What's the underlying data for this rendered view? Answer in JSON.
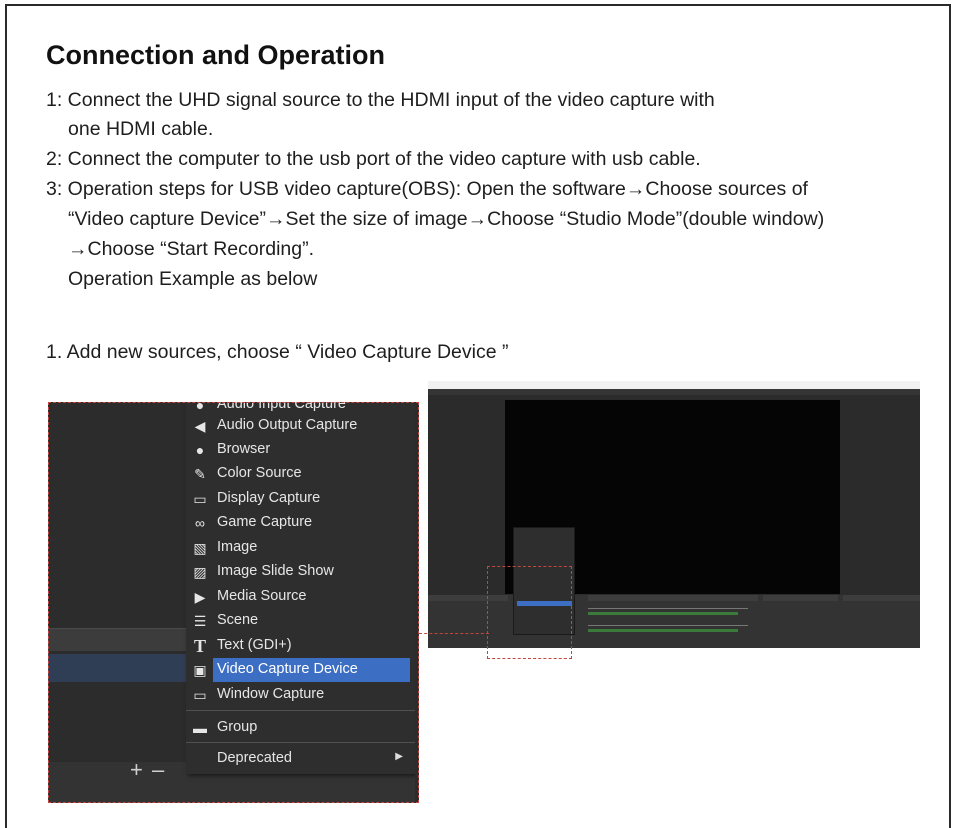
{
  "doc": {
    "title": "Connection and Operation",
    "steps": [
      "1: Connect the UHD signal source to the HDMI input of the video capture with",
      "one HDMI cable.",
      "2: Connect the computer to the usb port of the video capture with usb cable.",
      "3: Operation steps for USB video capture(OBS): Open the software→Choose sources of",
      "“Video capture Device”→Set the size of image→Choose “Studio Mode”(double window)",
      "→Choose “Start Recording”.",
      "Operation Example as below"
    ],
    "subheading": "1. Add new sources, choose “ Video Capture Device ”"
  },
  "menu": {
    "items": [
      {
        "icon": "microphone-icon",
        "glyph": "🎙",
        "label": "Audio Input Capture"
      },
      {
        "icon": "speaker-icon",
        "glyph": "◀",
        "label": "Audio Output Capture"
      },
      {
        "icon": "globe-icon",
        "glyph": "●",
        "label": "Browser"
      },
      {
        "icon": "brush-icon",
        "glyph": "✎",
        "label": "Color Source"
      },
      {
        "icon": "monitor-icon",
        "glyph": "▭",
        "label": "Display Capture"
      },
      {
        "icon": "gamepad-icon",
        "glyph": "∞",
        "label": "Game Capture"
      },
      {
        "icon": "image-icon",
        "glyph": "▧",
        "label": "Image"
      },
      {
        "icon": "slideshow-icon",
        "glyph": "▨",
        "label": "Image Slide Show"
      },
      {
        "icon": "play-icon",
        "glyph": "▶",
        "label": "Media Source"
      },
      {
        "icon": "list-icon",
        "glyph": "☰",
        "label": "Scene"
      },
      {
        "icon": "text-icon",
        "glyph": "T",
        "label": "Text (GDI+)"
      },
      {
        "icon": "camera-icon",
        "glyph": "▣",
        "label": "Video Capture Device"
      },
      {
        "icon": "window-icon",
        "glyph": "▭",
        "label": "Window Capture"
      },
      {
        "icon": "folder-icon",
        "glyph": "▬",
        "label": "Group"
      },
      {
        "icon": "",
        "glyph": "",
        "label": "Deprecated"
      }
    ],
    "selected": "Video Capture Device"
  },
  "colors": {
    "highlight": "#3c6fc4",
    "dashed_border": "#c0463f",
    "obs_background": "#2b2b2b"
  }
}
